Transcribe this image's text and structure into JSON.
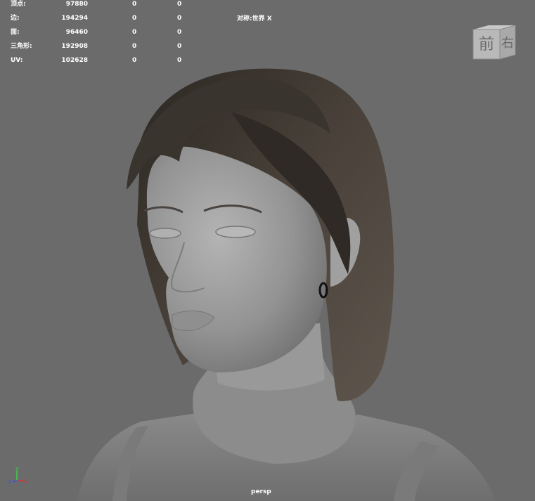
{
  "hud": {
    "rows": [
      {
        "label": "顶点:",
        "v1": "97880",
        "v2": "0",
        "v3": "0"
      },
      {
        "label": "边:",
        "v1": "194294",
        "v2": "0",
        "v3": "0"
      },
      {
        "label": "面:",
        "v1": "96460",
        "v2": "0",
        "v3": "0"
      },
      {
        "label": "三角形:",
        "v1": "192908",
        "v2": "0",
        "v3": "0"
      },
      {
        "label": "UV:",
        "v1": "102628",
        "v2": "0",
        "v3": "0"
      }
    ],
    "symmetry": "对称:世界 X"
  },
  "viewcube": {
    "front": "前",
    "right": "右"
  },
  "axis": {
    "x": "x",
    "y": "y",
    "z": "z"
  },
  "camera": "persp",
  "colors": {
    "background": "#6b6b6b",
    "hair": "#3a342e",
    "skin": "#9a9a9a",
    "text": "#ffffff"
  }
}
